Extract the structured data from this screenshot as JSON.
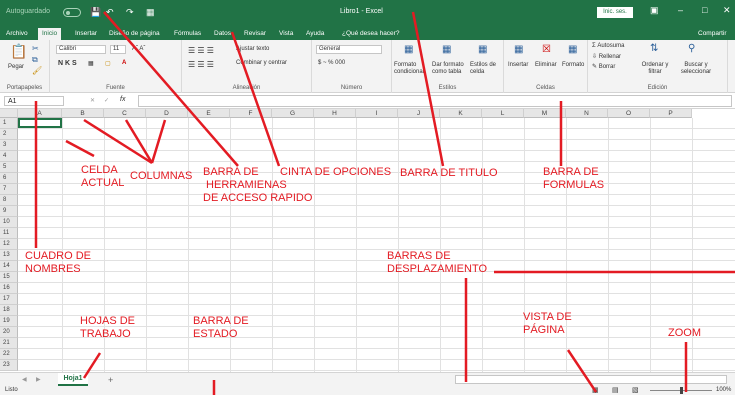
{
  "titlebar": {
    "autosave": "Autoguardado",
    "title": "Libro1 - Excel",
    "signin": "Inic. ses.",
    "save_icon": "save-icon",
    "undo_icon": "undo-icon",
    "redo_icon": "redo-icon"
  },
  "tabs": [
    "Archivo",
    "Inicio",
    "Insertar",
    "Diseño de página",
    "Fórmulas",
    "Datos",
    "Revisar",
    "Vista",
    "Ayuda",
    "¿Qué desea hacer?",
    "Compartir"
  ],
  "ribbon": {
    "pegar": "Pegar",
    "font_name": "Calibri",
    "font_size": "11",
    "ajustar": "Ajustar texto",
    "combinar": "Combinar y centrar",
    "number_format": "General",
    "num_symbols": "$ ~ % 000",
    "formato_cond": "Formato condicional",
    "dar_formato": "Dar formato como tabla",
    "estilos_celda": "Estilos de celda",
    "insertar": "Insertar",
    "eliminar": "Eliminar",
    "formato": "Formato",
    "autosuma": "Autosuma",
    "rellenar": "Rellenar",
    "borrar": "Borrar",
    "ordenar": "Ordenar y filtrar",
    "buscar": "Buscar y seleccionar",
    "groups": [
      "Portapapeles",
      "Fuente",
      "Alineación",
      "Número",
      "Estilos",
      "Celdas",
      "Edición"
    ]
  },
  "formula_bar": {
    "namebox": "A1",
    "fx": "fx"
  },
  "columns": [
    "A",
    "B",
    "C",
    "D",
    "E",
    "F",
    "G",
    "H",
    "I",
    "J",
    "K",
    "L",
    "M",
    "N",
    "O",
    "P"
  ],
  "rows": [
    "1",
    "2",
    "3",
    "4",
    "5",
    "6",
    "7",
    "8",
    "9",
    "10",
    "11",
    "12",
    "13",
    "14",
    "15",
    "16",
    "17",
    "18",
    "19",
    "20",
    "21",
    "22",
    "23"
  ],
  "sheet": {
    "name": "Hoja1",
    "add": "+"
  },
  "status": {
    "text": "Listo",
    "zoom": "100%"
  },
  "annotations": {
    "celda_actual": "CELDA\nACTUAL",
    "columnas": "COLUMNAS",
    "barra_herr": "BARRA DE\n HERRAMIENAS\nDE ACCESO RAPIDO",
    "cinta": "CINTA DE OPCIONES",
    "barra_titulo": "BARRA DE TITULO",
    "barra_formulas": "BARRA DE\nFORMULAS",
    "cuadro_nombres": "CUADRO DE\nNOMBRES",
    "barras_desp": "BARRAS DE\nDESPLAZAMIENTO",
    "hojas": "HOJAS DE\nTRABAJO",
    "barra_estado": "BARRA DE\nESTADO",
    "vista": "VISTA DE\nPÁGINA",
    "zoom": "ZOOM"
  }
}
